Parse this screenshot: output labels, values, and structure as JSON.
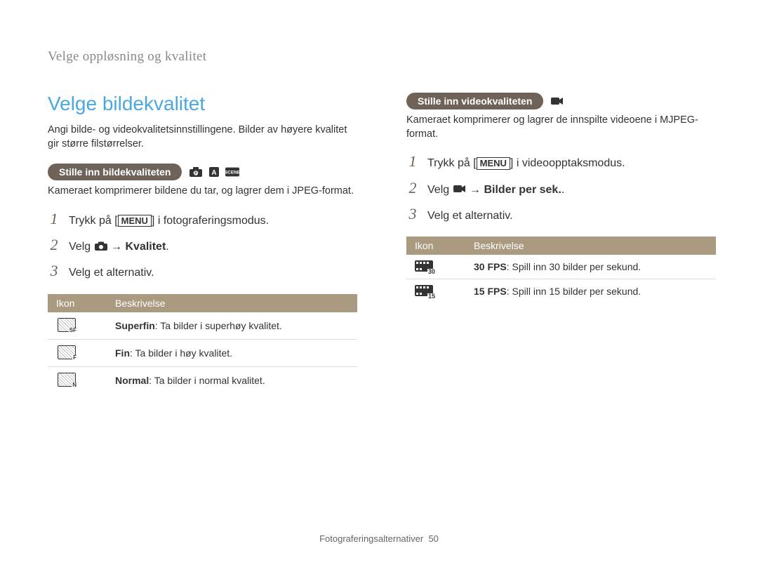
{
  "breadcrumb": "Velge oppløsning og kvalitet",
  "left": {
    "heading": "Velge bildekvalitet",
    "intro": "Angi bilde- og videokvalitetsinnstillingene. Bilder av høyere kvalitet gir større filstørrelser.",
    "pill": "Stille inn bildekvaliteten",
    "sub_desc": "Kameraet komprimerer bildene du tar, og lagrer dem i JPEG-format.",
    "steps": {
      "s1a": "Trykk på [",
      "s1_menu": "MENU",
      "s1b": "] i fotograferingsmodus.",
      "s2a": "Velg ",
      "s2b": " → ",
      "s2c": "Kvalitet",
      "s2d": ".",
      "s3": "Velg et alternativ."
    },
    "table": {
      "h_icon": "Ikon",
      "h_desc": "Beskrivelse",
      "rows": [
        {
          "icon_sub": "SF",
          "label": "Superfin",
          "text": ": Ta bilder i superhøy kvalitet."
        },
        {
          "icon_sub": "F",
          "label": "Fin",
          "text": ": Ta bilder i høy kvalitet."
        },
        {
          "icon_sub": "N",
          "label": "Normal",
          "text": ": Ta bilder i normal kvalitet."
        }
      ]
    }
  },
  "right": {
    "pill": "Stille inn videokvaliteten",
    "sub_desc": "Kameraet komprimerer og lagrer de innspilte videoene i MJPEG-format.",
    "steps": {
      "s1a": "Trykk på [",
      "s1_menu": "MENU",
      "s1b": "] i videoopptaksmodus.",
      "s2a": "Velg ",
      "s2b": " → ",
      "s2c": "Bilder per sek.",
      "s2d": ".",
      "s3": "Velg et alternativ."
    },
    "table": {
      "h_icon": "Ikon",
      "h_desc": "Beskrivelse",
      "rows": [
        {
          "icon_sub": "30",
          "label": "30 FPS",
          "text": ": Spill inn 30 bilder per sekund."
        },
        {
          "icon_sub": "15",
          "label": "15 FPS",
          "text": ": Spill inn 15 bilder per sekund."
        }
      ]
    }
  },
  "footer": {
    "section": "Fotograferingsalternativer",
    "page": "50"
  }
}
